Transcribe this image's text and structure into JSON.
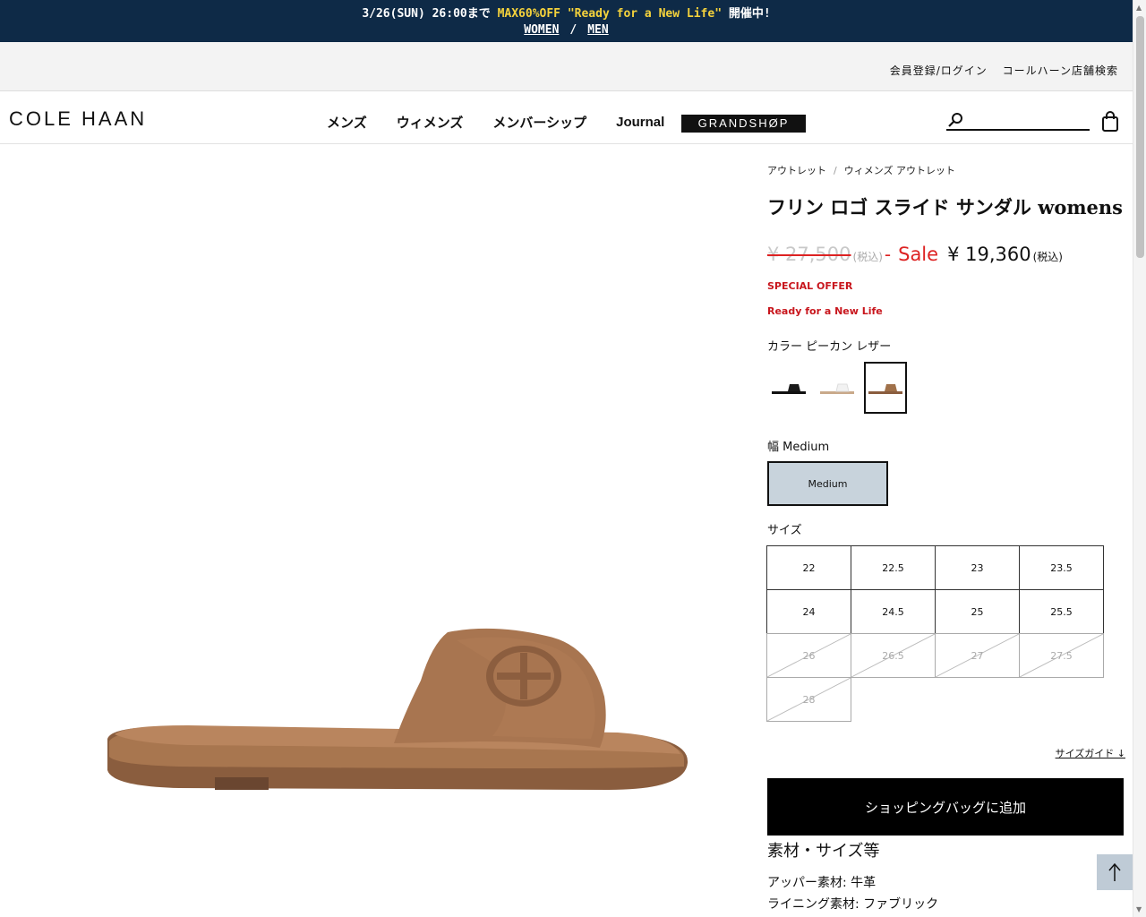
{
  "promo": {
    "date_text": "3/26(SUN) 26:00まで ",
    "highlight": "MAX60%OFF \"Ready for a New Life\"",
    "suffix": " 開催中!",
    "women_link": "WOMEN",
    "separator": "/",
    "men_link": "MEN"
  },
  "utility": {
    "login": "会員登録/ログイン",
    "store_search": "コールハーン店舗検索"
  },
  "header": {
    "logo": "COLE HAAN",
    "nav": [
      "メンズ",
      "ウィメンズ",
      "メンバーシップ",
      "Journal"
    ],
    "grandshop": "GRANDSHØP",
    "search_placeholder": ""
  },
  "breadcrumb": {
    "items": [
      "アウトレット",
      "ウィメンズ アウトレット"
    ],
    "separator": "/"
  },
  "product": {
    "title": "フリン ロゴ スライド サンダル womens",
    "old_price": "¥ 27,500",
    "tax_note": "(税込)",
    "dash": "-",
    "sale_label": "Sale",
    "new_price": "¥ 19,360",
    "special_offer": "SPECIAL OFFER",
    "campaign": "Ready for a New Life",
    "color_label": "カラー ピーカン レザー",
    "swatches": [
      {
        "name": "ブラック",
        "color": "#1a1a1a",
        "selected": false
      },
      {
        "name": "ホワイト",
        "color": "#eeeeee",
        "selected": false
      },
      {
        "name": "ピーカン レザー",
        "color": "#a0714a",
        "selected": true
      }
    ],
    "width_label": "幅 Medium",
    "width_option": "Medium",
    "size_label": "サイズ",
    "sizes": [
      {
        "value": "22",
        "available": true
      },
      {
        "value": "22.5",
        "available": true
      },
      {
        "value": "23",
        "available": true
      },
      {
        "value": "23.5",
        "available": true
      },
      {
        "value": "24",
        "available": true
      },
      {
        "value": "24.5",
        "available": true
      },
      {
        "value": "25",
        "available": true
      },
      {
        "value": "25.5",
        "available": true
      },
      {
        "value": "26",
        "available": false
      },
      {
        "value": "26.5",
        "available": false
      },
      {
        "value": "27",
        "available": false
      },
      {
        "value": "27.5",
        "available": false
      },
      {
        "value": "28",
        "available": false
      }
    ],
    "size_guide": "サイズガイド ↓",
    "add_to_bag": "ショッピングバッグに追加",
    "material_heading": "素材・サイズ等",
    "upper_material": "アッパー素材: 牛革",
    "lining_material": "ライニング素材: ファブリック"
  },
  "colors": {
    "promo_bg": "#0e2a47",
    "promo_highlight": "#f4d23c",
    "sale_red": "#d22222",
    "leather": "#a0714a",
    "width_selected_bg": "#c8d3dc"
  },
  "icons": {
    "search": "search-icon",
    "bag": "bag-icon",
    "back_to_top": "arrow-up-icon"
  }
}
